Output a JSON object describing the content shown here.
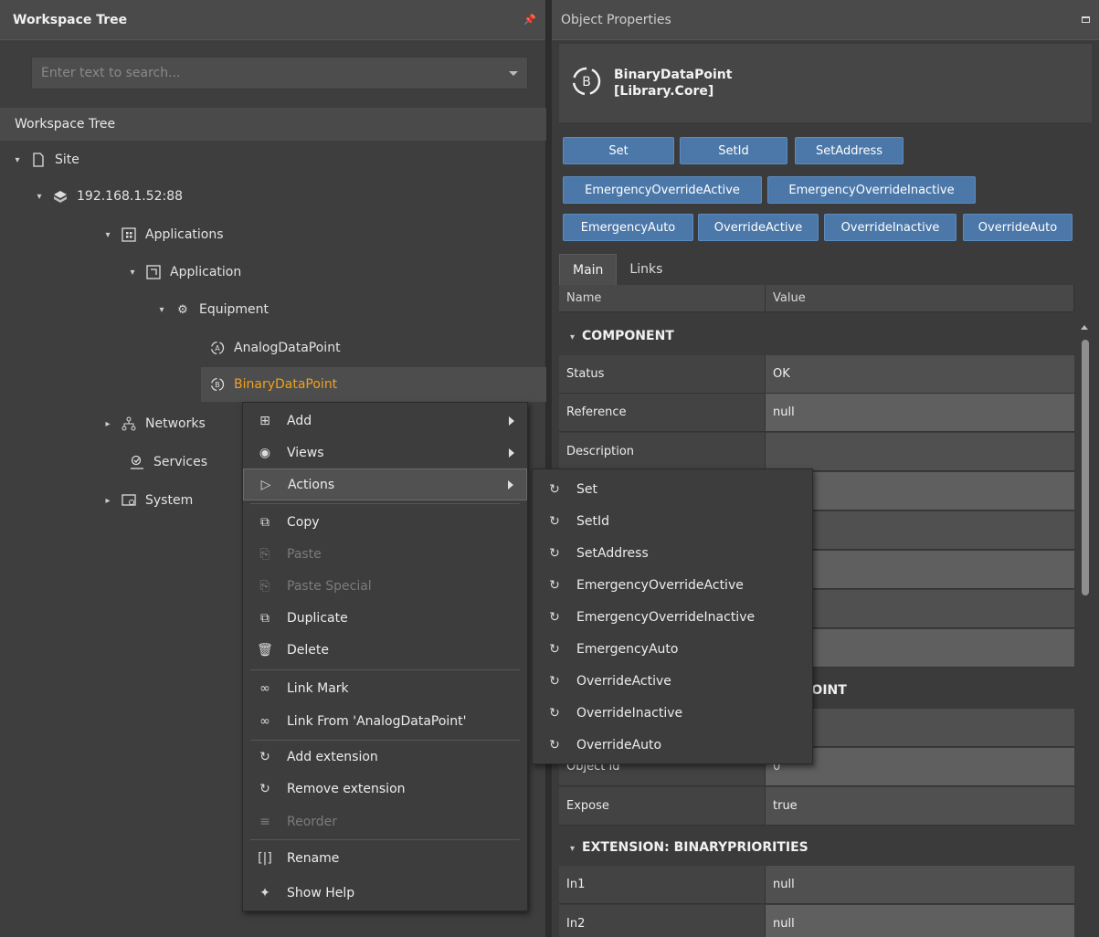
{
  "left_panel": {
    "header_title": "Workspace Tree",
    "search_placeholder": "Enter text to search...",
    "tree_title": "Workspace Tree"
  },
  "tree": [
    {
      "label": "Site",
      "icon": "page-icon"
    },
    {
      "label": "192.168.1.52:88",
      "icon": "server-icon"
    },
    {
      "label": "Applications",
      "icon": "applications-icon"
    },
    {
      "label": "Application",
      "icon": "application-icon"
    },
    {
      "label": "Equipment",
      "icon": "equipment-gear-icon"
    },
    {
      "label": "AnalogDataPoint",
      "icon": "analog-datapoint-icon"
    },
    {
      "label": "BinaryDataPoint",
      "icon": "binary-datapoint-icon",
      "selected": true
    },
    {
      "label": "Networks",
      "icon": "networks-icon"
    },
    {
      "label": "Services",
      "icon": "services-icon"
    },
    {
      "label": "System",
      "icon": "system-icon"
    }
  ],
  "context_menu": [
    {
      "label": "Add",
      "icon": "add-icon",
      "submenu": true
    },
    {
      "label": "Views",
      "icon": "eye-icon",
      "submenu": true
    },
    {
      "label": "Actions",
      "icon": "play-circle-icon",
      "submenu": true,
      "active": true
    },
    {
      "label": "Copy",
      "icon": "copy-icon"
    },
    {
      "label": "Paste",
      "icon": "paste-icon",
      "disabled": true
    },
    {
      "label": "Paste Special",
      "icon": "paste-special-icon",
      "disabled": true
    },
    {
      "label": "Duplicate",
      "icon": "duplicate-icon"
    },
    {
      "label": "Delete",
      "icon": "trash-icon"
    },
    {
      "label": "Link Mark",
      "icon": "link-icon"
    },
    {
      "label": "Link From 'AnalogDataPoint'",
      "icon": "link-from-icon"
    },
    {
      "label": "Add extension",
      "icon": "action-icon"
    },
    {
      "label": "Remove extension",
      "icon": "action-icon"
    },
    {
      "label": "Reorder",
      "icon": "reorder-icon",
      "disabled": true
    },
    {
      "label": "Rename",
      "icon": "rename-icon"
    },
    {
      "label": "Show Help",
      "icon": "help-bulb-icon"
    }
  ],
  "actions_submenu": [
    "Set",
    "SetId",
    "SetAddress",
    "EmergencyOverrideActive",
    "EmergencyOverrideInactive",
    "EmergencyAuto",
    "OverrideActive",
    "OverrideInactive",
    "OverrideAuto"
  ],
  "right_panel": {
    "header_title": "Object Properties",
    "object_name": "BinaryDataPoint",
    "object_library": "[Library.Core]",
    "object_icon_letter": "B"
  },
  "action_buttons": [
    "Set",
    "SetId",
    "SetAddress",
    "EmergencyOverrideActive",
    "EmergencyOverrideInactive",
    "EmergencyAuto",
    "OverrideActive",
    "OverrideInactive",
    "OverrideAuto"
  ],
  "tabs": [
    "Main",
    "Links"
  ],
  "grid": {
    "col_name": "Name",
    "col_value": "Value",
    "section_component": "COMPONENT",
    "section_binarypoint": "EXTENSION: BINARYPOINT",
    "section_binarypoint_visible": "RYPOINT",
    "section_priorities": "EXTENSION: BINARYPRIORITIES",
    "rows": [
      {
        "name": "Status",
        "value": "OK"
      },
      {
        "name": "Reference",
        "value": "null"
      },
      {
        "name": "Description",
        "value": ""
      },
      {
        "name": "",
        "value": ""
      },
      {
        "name": "",
        "value": ""
      },
      {
        "name": "",
        "value": ""
      },
      {
        "name": "",
        "value": ""
      },
      {
        "name": "",
        "value": ""
      },
      {
        "name": "",
        "value": ""
      },
      {
        "name": "Object Id",
        "value": "0"
      },
      {
        "name": "Expose",
        "value": "true"
      },
      {
        "name": "In1",
        "value": "null"
      },
      {
        "name": "In2",
        "value": "null"
      }
    ]
  }
}
